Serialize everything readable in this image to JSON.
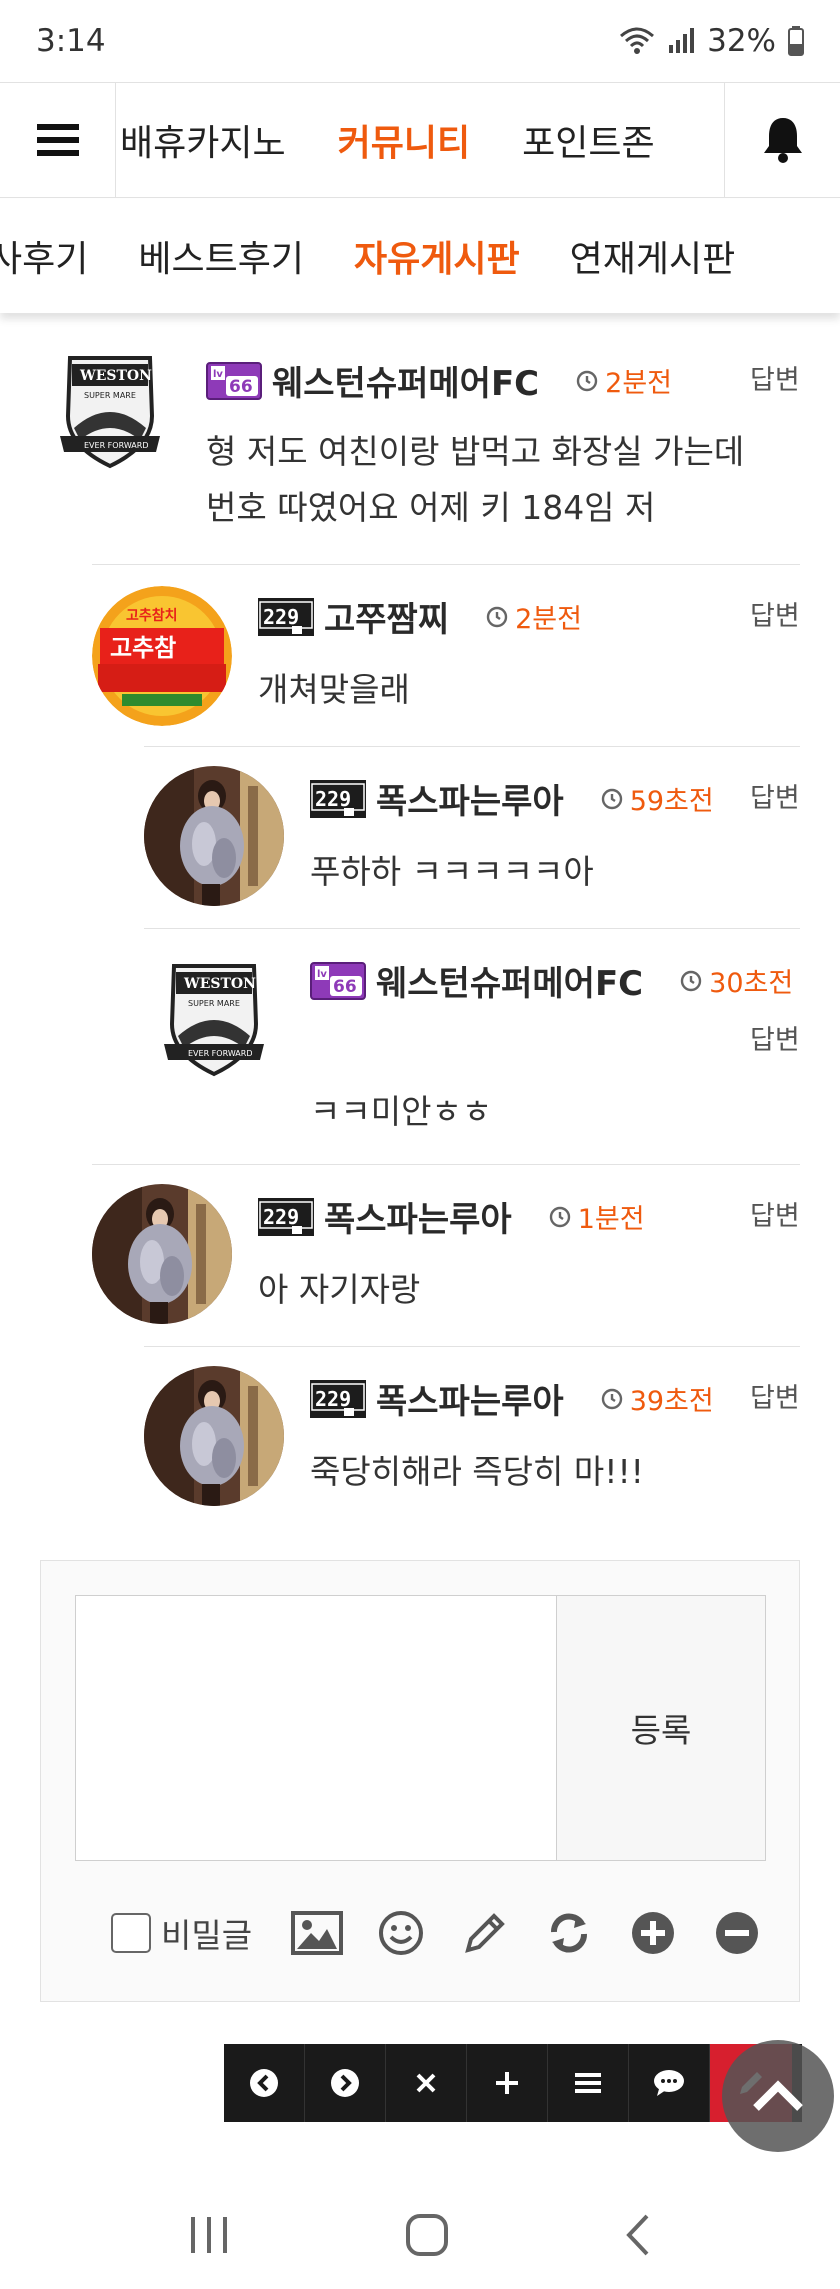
{
  "status_bar": {
    "time": "3:14",
    "battery": "32%"
  },
  "top_nav": {
    "items": [
      {
        "label": "배휴카지노",
        "active": false
      },
      {
        "label": "커뮤니티",
        "active": true
      },
      {
        "label": "포인트존",
        "active": false
      }
    ]
  },
  "sub_nav": {
    "items": [
      {
        "label": "사후기",
        "active": false
      },
      {
        "label": "베스트후기",
        "active": false
      },
      {
        "label": "자유게시판",
        "active": true
      },
      {
        "label": "연재게시판",
        "active": false
      }
    ]
  },
  "comments": [
    {
      "user": "웨스턴슈퍼메어FC",
      "badge": "lv66",
      "avatar": "weston-crest",
      "time": "2분전",
      "reply": "답변",
      "text_lines": [
        "형 저도 여친이랑 밥먹고 화장실 가는데",
        "번호 따였어요 어제 키 184임 저"
      ]
    },
    {
      "user": "고쭈짬찌",
      "badge": "admin",
      "avatar": "tuna-can",
      "time": "2분전",
      "reply": "답변",
      "text_lines": [
        "개쳐맞을래"
      ]
    },
    {
      "user": "폭스파는루아",
      "badge": "admin",
      "avatar": "woman-photo",
      "time": "59초전",
      "reply": "답변",
      "text_lines": [
        "푸하하 ㅋㅋㅋㅋㅋ아"
      ]
    },
    {
      "user": "웨스턴슈퍼메어FC",
      "badge": "lv66",
      "avatar": "weston-crest",
      "time": "30초전",
      "reply": "답변",
      "text_lines": [
        "ㅋㅋ미안ㅎㅎ"
      ]
    },
    {
      "user": "폭스파는루아",
      "badge": "admin",
      "avatar": "woman-photo",
      "time": "1분전",
      "reply": "답변",
      "text_lines": [
        "아 자기자랑"
      ]
    },
    {
      "user": "폭스파는루아",
      "badge": "admin",
      "avatar": "woman-photo",
      "time": "39초전",
      "reply": "답변",
      "text_lines": [
        "죽당히해라 즉당히 마!!!"
      ]
    }
  ],
  "write_box": {
    "submit_label": "등록",
    "secret_label": "비밀글",
    "secret_checked": false
  },
  "colors": {
    "accent": "#ef5a0e",
    "toolbar_bg": "#1a1a1a",
    "toolbar_red": "#d71f2e"
  }
}
